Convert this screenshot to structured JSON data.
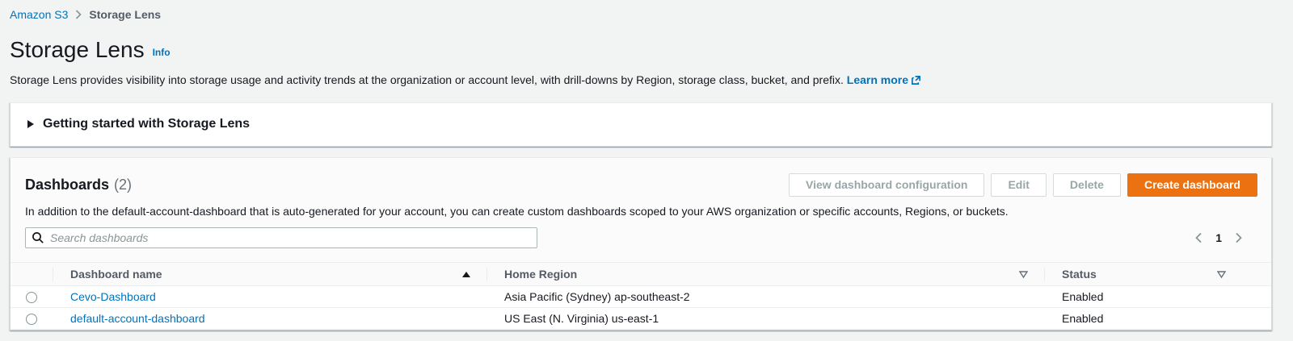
{
  "breadcrumb": {
    "items": [
      {
        "label": "Amazon S3"
      },
      {
        "label": "Storage Lens"
      }
    ]
  },
  "page_header": {
    "title": "Storage Lens",
    "info_label": "Info",
    "description": "Storage Lens provides visibility into storage usage and activity trends at the organization or account level, with drill-downs by Region, storage class, bucket, and prefix.",
    "learn_more_label": "Learn more"
  },
  "getting_started": {
    "title": "Getting started with Storage Lens"
  },
  "dashboards": {
    "title": "Dashboards",
    "count": "(2)",
    "description": "In addition to the default-account-dashboard that is auto-generated for your account, you can create custom dashboards scoped to your AWS organization or specific accounts, Regions, or buckets.",
    "actions": {
      "view_configuration": "View dashboard configuration",
      "edit": "Edit",
      "delete": "Delete",
      "create": "Create dashboard"
    },
    "search": {
      "placeholder": "Search dashboards"
    },
    "pagination": {
      "current_page": "1"
    },
    "table": {
      "columns": {
        "name": "Dashboard name",
        "home_region": "Home Region",
        "status": "Status"
      },
      "rows": [
        {
          "name": "Cevo-Dashboard",
          "home_region": "Asia Pacific (Sydney) ap-southeast-2",
          "status": "Enabled"
        },
        {
          "name": "default-account-dashboard",
          "home_region": "US East (N. Virginia) us-east-1",
          "status": "Enabled"
        }
      ]
    }
  },
  "colors": {
    "accent_orange": "#ec7211",
    "link_blue": "#0073bb",
    "page_background": "#f2f3f3"
  }
}
